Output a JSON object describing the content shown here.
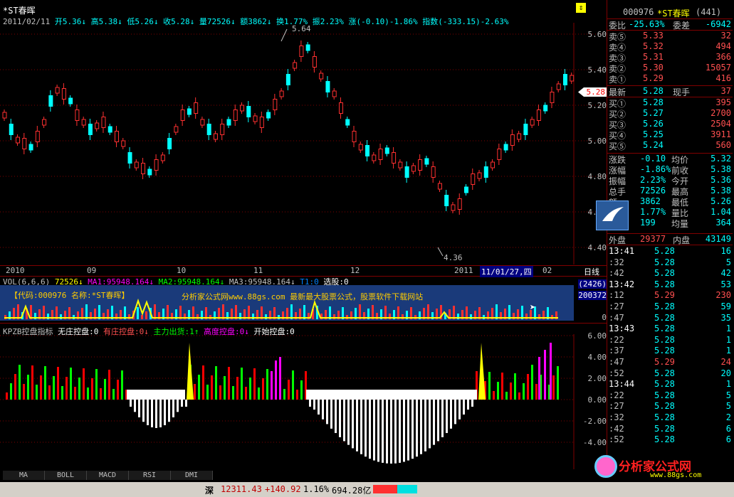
{
  "header": {
    "name": "*ST春晖",
    "date": "2011/02/11",
    "open_label": "开",
    "open": "5.36",
    "high_label": "高",
    "high": "5.38",
    "low_label": "低",
    "low": "5.26",
    "close_label": "收",
    "close": "5.28",
    "vol_label": "量",
    "vol": "72526",
    "amt_label": "额",
    "amt": "3862",
    "turn_label": "换",
    "turn": "1.77%",
    "amp_label": "振",
    "amp": "2.23%",
    "chg": "涨(-0.10)-1.86%",
    "index": "指数(-333.15)-2.63%"
  },
  "price_axis": [
    "5.60",
    "5.40",
    "5.20",
    "5.00",
    "4.80",
    "4.60",
    "4.40"
  ],
  "price_marker": "5.28",
  "annotations": {
    "high_label": "5.64",
    "low_label": "4.36"
  },
  "xaxis": {
    "labels": [
      "2010",
      "09",
      "10",
      "11",
      "12",
      "2011",
      "11/01/27,四",
      "02"
    ],
    "period": "日线"
  },
  "vol_panel": {
    "title": "VOL(6,6,6)",
    "vol": "72526",
    "ma1": "MA1:95948.164",
    "ma2": "MA2:95948.164",
    "ma3": "MA3:95948.164",
    "t1": "T1:0",
    "xuangu": "选股:0",
    "banner": "【代码:000976 名称:*ST春晖】",
    "ad": "分析家公式网www.88gs.com 最新最大股票公式，股票软件下载网站",
    "axis_top": "(2426)",
    "axis_mid": "200372",
    "axis_zero": "0"
  },
  "kpzb_panel": {
    "title": "KPZB控盘指标",
    "items": [
      "无庄控盘:0",
      "有庄控盘:0",
      "主力出货:1",
      "高度控盘:0",
      "开始控盘:0"
    ],
    "axis": [
      "6.00",
      "4.00",
      "2.00",
      "0.00",
      "-2.00",
      "-4.00"
    ]
  },
  "bottom_tabs": [
    "MA",
    "BOLL",
    "MACD",
    "RSI",
    "DMI"
  ],
  "right": {
    "code": "000976",
    "name": "*ST春晖",
    "count": "(441)",
    "weibi_label": "委比",
    "weibi": "-25.63%",
    "weicha_label": "委差",
    "weicha": "-6942",
    "asks": [
      {
        "label": "卖⑤",
        "price": "5.33",
        "vol": "32"
      },
      {
        "label": "卖④",
        "price": "5.32",
        "vol": "494"
      },
      {
        "label": "卖③",
        "price": "5.31",
        "vol": "366"
      },
      {
        "label": "卖②",
        "price": "5.30",
        "vol": "15057"
      },
      {
        "label": "卖①",
        "price": "5.29",
        "vol": "416"
      }
    ],
    "latest_label": "最新",
    "latest": "5.28",
    "xianshou_label": "现手",
    "xianshou": "37",
    "bids": [
      {
        "label": "买①",
        "price": "5.28",
        "vol": "395"
      },
      {
        "label": "买②",
        "price": "5.27",
        "vol": "2700"
      },
      {
        "label": "买③",
        "price": "5.26",
        "vol": "2504"
      },
      {
        "label": "买④",
        "price": "5.25",
        "vol": "3911"
      },
      {
        "label": "买⑤",
        "price": "5.24",
        "vol": "560"
      }
    ],
    "stats": [
      {
        "l1": "涨跌",
        "v1": "-0.10",
        "l2": "均价",
        "v2": "5.32"
      },
      {
        "l1": "涨幅",
        "v1": "-1.86%",
        "l2": "前收",
        "v2": "5.38"
      },
      {
        "l1": "振幅",
        "v1": "2.23%",
        "l2": "今开",
        "v2": "5.36"
      },
      {
        "l1": "总手",
        "v1": "72526",
        "l2": "最高",
        "v2": "5.38"
      },
      {
        "l1": "额",
        "v1": "3862",
        "l2": "最低",
        "v2": "5.26"
      },
      {
        "l1": "手",
        "v1": "1.77%",
        "l2": "量比",
        "v2": "1.04"
      },
      {
        "l1": "分笔",
        "v1": "199",
        "l2": "均量",
        "v2": "364"
      }
    ],
    "waipan_label": "外盘",
    "waipan": "29377",
    "neipan_label": "内盘",
    "neipan": "43149",
    "ticks": [
      {
        "t": "13:41",
        "p": "5.28",
        "v": "16"
      },
      {
        "t": ":32",
        "p": "5.28",
        "v": "5"
      },
      {
        "t": ":42",
        "p": "5.28",
        "v": "42"
      },
      {
        "t": "13:42",
        "p": "5.28",
        "v": "53"
      },
      {
        "t": ":12",
        "p": "5.29",
        "v": "230"
      },
      {
        "t": ":27",
        "p": "5.28",
        "v": "59"
      },
      {
        "t": ":47",
        "p": "5.28",
        "v": "35"
      },
      {
        "t": "13:43",
        "p": "5.28",
        "v": "1"
      },
      {
        "t": ":22",
        "p": "5.28",
        "v": "1"
      },
      {
        "t": ":37",
        "p": "5.28",
        "v": "1"
      },
      {
        "t": ":47",
        "p": "5.29",
        "v": "24"
      },
      {
        "t": ":52",
        "p": "5.28",
        "v": "20"
      },
      {
        "t": "13:44",
        "p": "5.28",
        "v": "1"
      },
      {
        "t": ":22",
        "p": "5.28",
        "v": "5"
      },
      {
        "t": ":27",
        "p": "5.28",
        "v": "5"
      },
      {
        "t": ":32",
        "p": "5.28",
        "v": "2"
      },
      {
        "t": ":42",
        "p": "5.28",
        "v": "6"
      },
      {
        "t": ":52",
        "p": "5.28",
        "v": "6"
      }
    ],
    "logo_text": "分析家公式网",
    "logo_url": "www.88gs.com"
  },
  "statusbar": {
    "market": "深",
    "index": "12311.43",
    "change": "+140.92",
    "pct": "1.16%",
    "amount": "694.28亿"
  },
  "colors": {
    "up": "#ff3030",
    "down": "#00ffff",
    "bg": "#000000",
    "grid": "#800000"
  }
}
